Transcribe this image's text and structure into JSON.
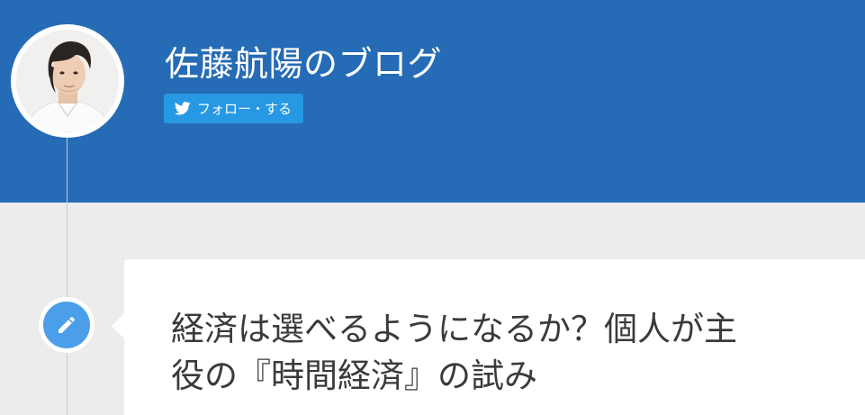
{
  "header": {
    "blog_title": "佐藤航陽のブログ",
    "follow_button_label": "フォロー・する",
    "avatar_icon": "author-avatar",
    "twitter_icon": "twitter-bird-icon",
    "background_color": "#266bb5",
    "follow_button_color": "#2798e3"
  },
  "entry": {
    "icon": "pencil-icon",
    "icon_color": "#4b9fea",
    "title_line1": "経済は選べるようになるか？個人が主",
    "title_line2": "役の『時間経済』の試み"
  },
  "colors": {
    "page_background": "#ececec",
    "card_background": "#ffffff",
    "title_text": "#3a3a3a"
  }
}
